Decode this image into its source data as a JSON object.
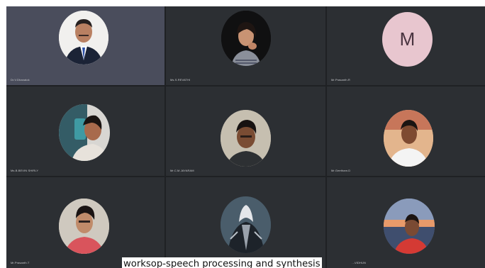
{
  "participants": [
    {
      "name": "Dr.V.Dhanalok",
      "avatar_icon": "person-suit-photo-icon",
      "active": true
    },
    {
      "name": "Ms.S.REVATHI",
      "avatar_icon": "person-photo-icon"
    },
    {
      "name": "Mr.Prasanth.R",
      "avatar_icon": "letter-avatar",
      "initial": "M",
      "avatar_color": "#e8c6cf"
    },
    {
      "name": "Ms.B.BEVIN SHIRLY",
      "avatar_icon": "person-selfie-photo-icon"
    },
    {
      "name": "Mr.C.M.JAYARAM",
      "avatar_icon": "person-photo-icon"
    },
    {
      "name": "Mr.Geetham.D",
      "avatar_icon": "person-photo-icon"
    },
    {
      "name": "Mr.Prasanth.T",
      "avatar_icon": "person-photo-icon"
    },
    {
      "name": "",
      "avatar_icon": "game-character-photo-icon"
    },
    {
      "name": "...VIDHUN",
      "avatar_icon": "person-sunset-photo-icon"
    }
  ],
  "caption": "worksop-speech processing and synthesis"
}
